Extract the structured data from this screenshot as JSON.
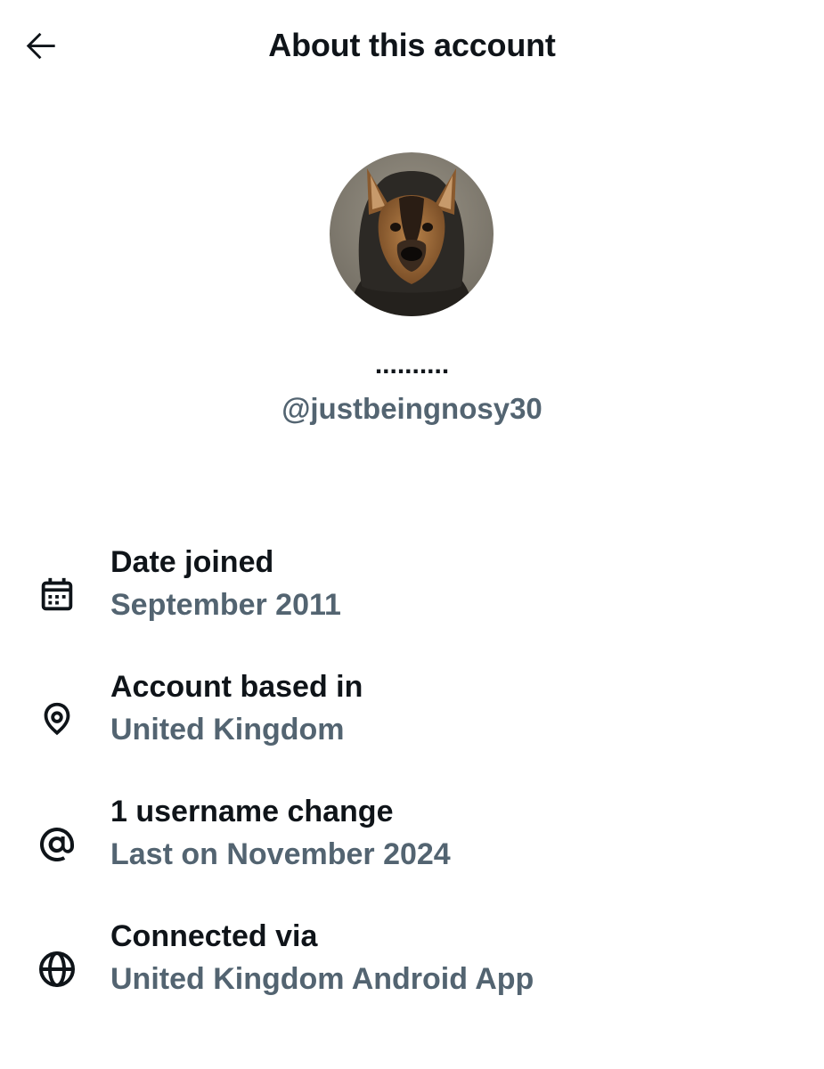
{
  "header": {
    "title": "About this account",
    "back_icon": "arrow-left-icon"
  },
  "profile": {
    "display_name": "..........",
    "handle": "@justbeingnosy30",
    "avatar_icon": "dog-avatar"
  },
  "details": [
    {
      "icon": "calendar-icon",
      "title": "Date joined",
      "value": "September 2011"
    },
    {
      "icon": "location-pin-icon",
      "title": "Account based in",
      "value": "United Kingdom"
    },
    {
      "icon": "at-sign-icon",
      "title": "1 username change",
      "value": "Last on November 2024"
    },
    {
      "icon": "globe-icon",
      "title": "Connected via",
      "value": "United Kingdom Android App"
    }
  ],
  "colors": {
    "primary_text": "#0f1419",
    "secondary_text": "#536471",
    "background": "#ffffff"
  }
}
